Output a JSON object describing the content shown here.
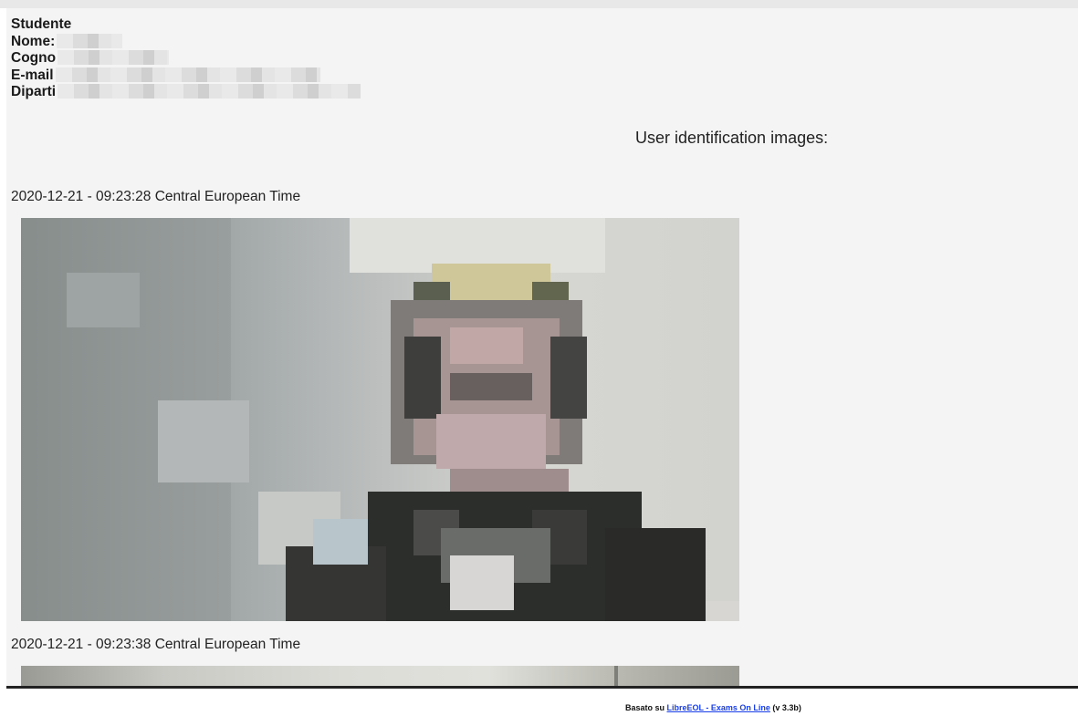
{
  "student": {
    "heading": "Studente",
    "name_label": "Nome:",
    "surname_label": "Cogno",
    "email_label": "E-mail",
    "department_label": "Diparti"
  },
  "identification": {
    "title": "User identification images:",
    "images": [
      {
        "timestamp": "2020-12-21 - 09:23:28 Central European Time"
      },
      {
        "timestamp": "2020-12-21 - 09:23:38 Central European Time"
      }
    ]
  },
  "footer": {
    "prefix": "Basato su",
    "link_text": "LibreEOL - Exams On Line",
    "suffix": "(v 3.3b)"
  }
}
